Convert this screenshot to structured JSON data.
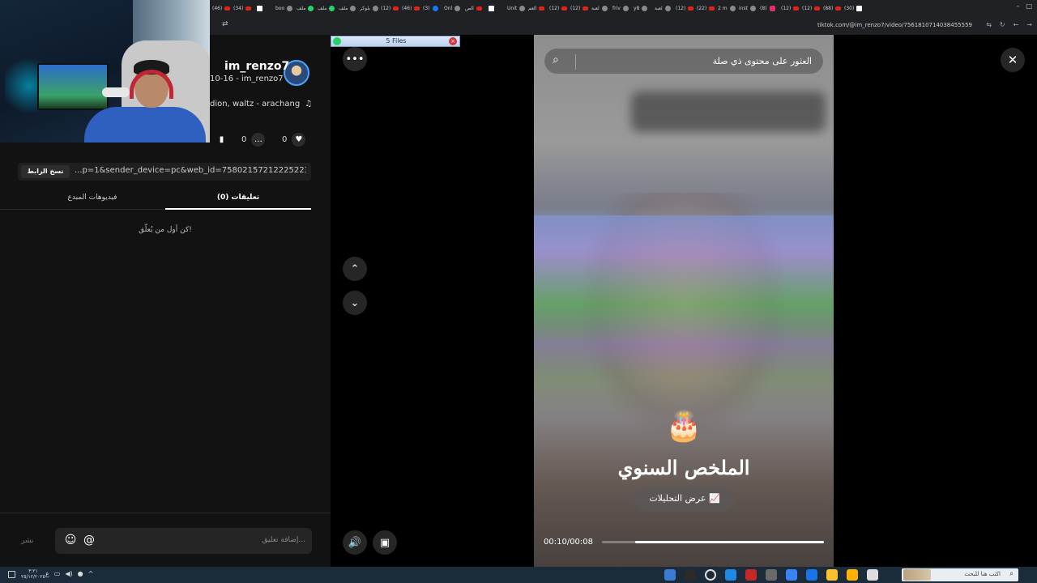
{
  "browser": {
    "tabs": [
      {
        "label": "(46)",
        "icon": "youtube-icon",
        "color": "red"
      },
      {
        "label": "(34)",
        "icon": "youtube-icon",
        "color": "red"
      },
      {
        "label": "",
        "icon": "tiktok-icon",
        "color": "tt"
      },
      {
        "label": "boo",
        "icon": "globe-icon",
        "color": "grey"
      },
      {
        "label": "ملف",
        "icon": "drive-icon",
        "color": "green"
      },
      {
        "label": "ملف",
        "icon": "excel-icon",
        "color": "green"
      },
      {
        "label": "ملف",
        "icon": "globe-icon",
        "color": "grey"
      },
      {
        "label": "بلوكر",
        "icon": "globe-icon",
        "color": "grey"
      },
      {
        "label": "(12)",
        "icon": "youtube-icon",
        "color": "red"
      },
      {
        "label": "(46)",
        "icon": "youtube-icon",
        "color": "red"
      },
      {
        "label": "(3)",
        "icon": "facebook-icon",
        "color": "blue"
      },
      {
        "label": "Onl",
        "icon": "globe-icon",
        "color": "grey"
      },
      {
        "label": "الص",
        "icon": "youtube-icon",
        "color": "red"
      },
      {
        "label": "",
        "icon": "tiktok-icon",
        "color": "tt"
      },
      {
        "label": "Unit",
        "icon": "globe-icon",
        "color": "grey"
      },
      {
        "label": "العم",
        "icon": "youtube-icon",
        "color": "red"
      },
      {
        "label": "(12)",
        "icon": "youtube-icon",
        "color": "red"
      },
      {
        "label": "(12)",
        "icon": "youtube-icon",
        "color": "red"
      },
      {
        "label": "لعبة",
        "icon": "globe-icon",
        "color": "grey"
      },
      {
        "label": "friv",
        "icon": "globe-icon",
        "color": "grey"
      },
      {
        "label": "y8",
        "icon": "globe-icon",
        "color": "grey"
      },
      {
        "label": "لعبة",
        "icon": "globe-icon",
        "color": "grey"
      },
      {
        "label": "(12)",
        "icon": "youtube-icon",
        "color": "red"
      },
      {
        "label": "(22)",
        "icon": "youtube-icon",
        "color": "red"
      },
      {
        "label": "2 m",
        "icon": "globe-icon",
        "color": "grey"
      },
      {
        "label": "inst",
        "icon": "globe-icon",
        "color": "grey"
      },
      {
        "label": "(8)",
        "icon": "instagram-icon",
        "color": "pink"
      },
      {
        "label": "(12)",
        "icon": "youtube-icon",
        "color": "red"
      },
      {
        "label": "(12)",
        "icon": "youtube-icon",
        "color": "red"
      },
      {
        "label": "(88)",
        "icon": "youtube-icon",
        "color": "red"
      },
      {
        "label": "(30)",
        "icon": "tiktok-icon",
        "color": "tt"
      }
    ],
    "url": "tiktok.com/@im_renzo7/video/7561810714038455559"
  },
  "mini_window": {
    "title": "5 Files"
  },
  "profile": {
    "username": "im_renzo7",
    "subline": "10-16 - im_renzo7",
    "music": "dion, waltz - arachang"
  },
  "stats": {
    "comments": "0",
    "likes": "0"
  },
  "share": {
    "copy_label": "نسخ الرابط",
    "link": "...p=1&sender_device=pc&web_id=7580215721222522385"
  },
  "panel_tabs": {
    "comments": "تعليقات (0)",
    "creator_videos": "فيديوهات المبدع"
  },
  "empty_message": "كن أول من يُعلّق!",
  "comment_input": {
    "placeholder": "إضافة تعليق...",
    "post_label": "نشر"
  },
  "video": {
    "search_placeholder": "العثور على محتوى ذي صلة",
    "recap_title": "الملخص السنوي",
    "analytics_label": "عرض التحليلات",
    "time": "00:10/00:08",
    "progress": 0.85
  },
  "taskbar": {
    "search_placeholder": "اكتب هنا للبحث",
    "clock_time": "٣:٢١",
    "clock_date": "٢٥/١٢/٢٠٢٥"
  },
  "colors": {
    "accent": "#ffffff",
    "tiktok_bg": "#121212"
  }
}
